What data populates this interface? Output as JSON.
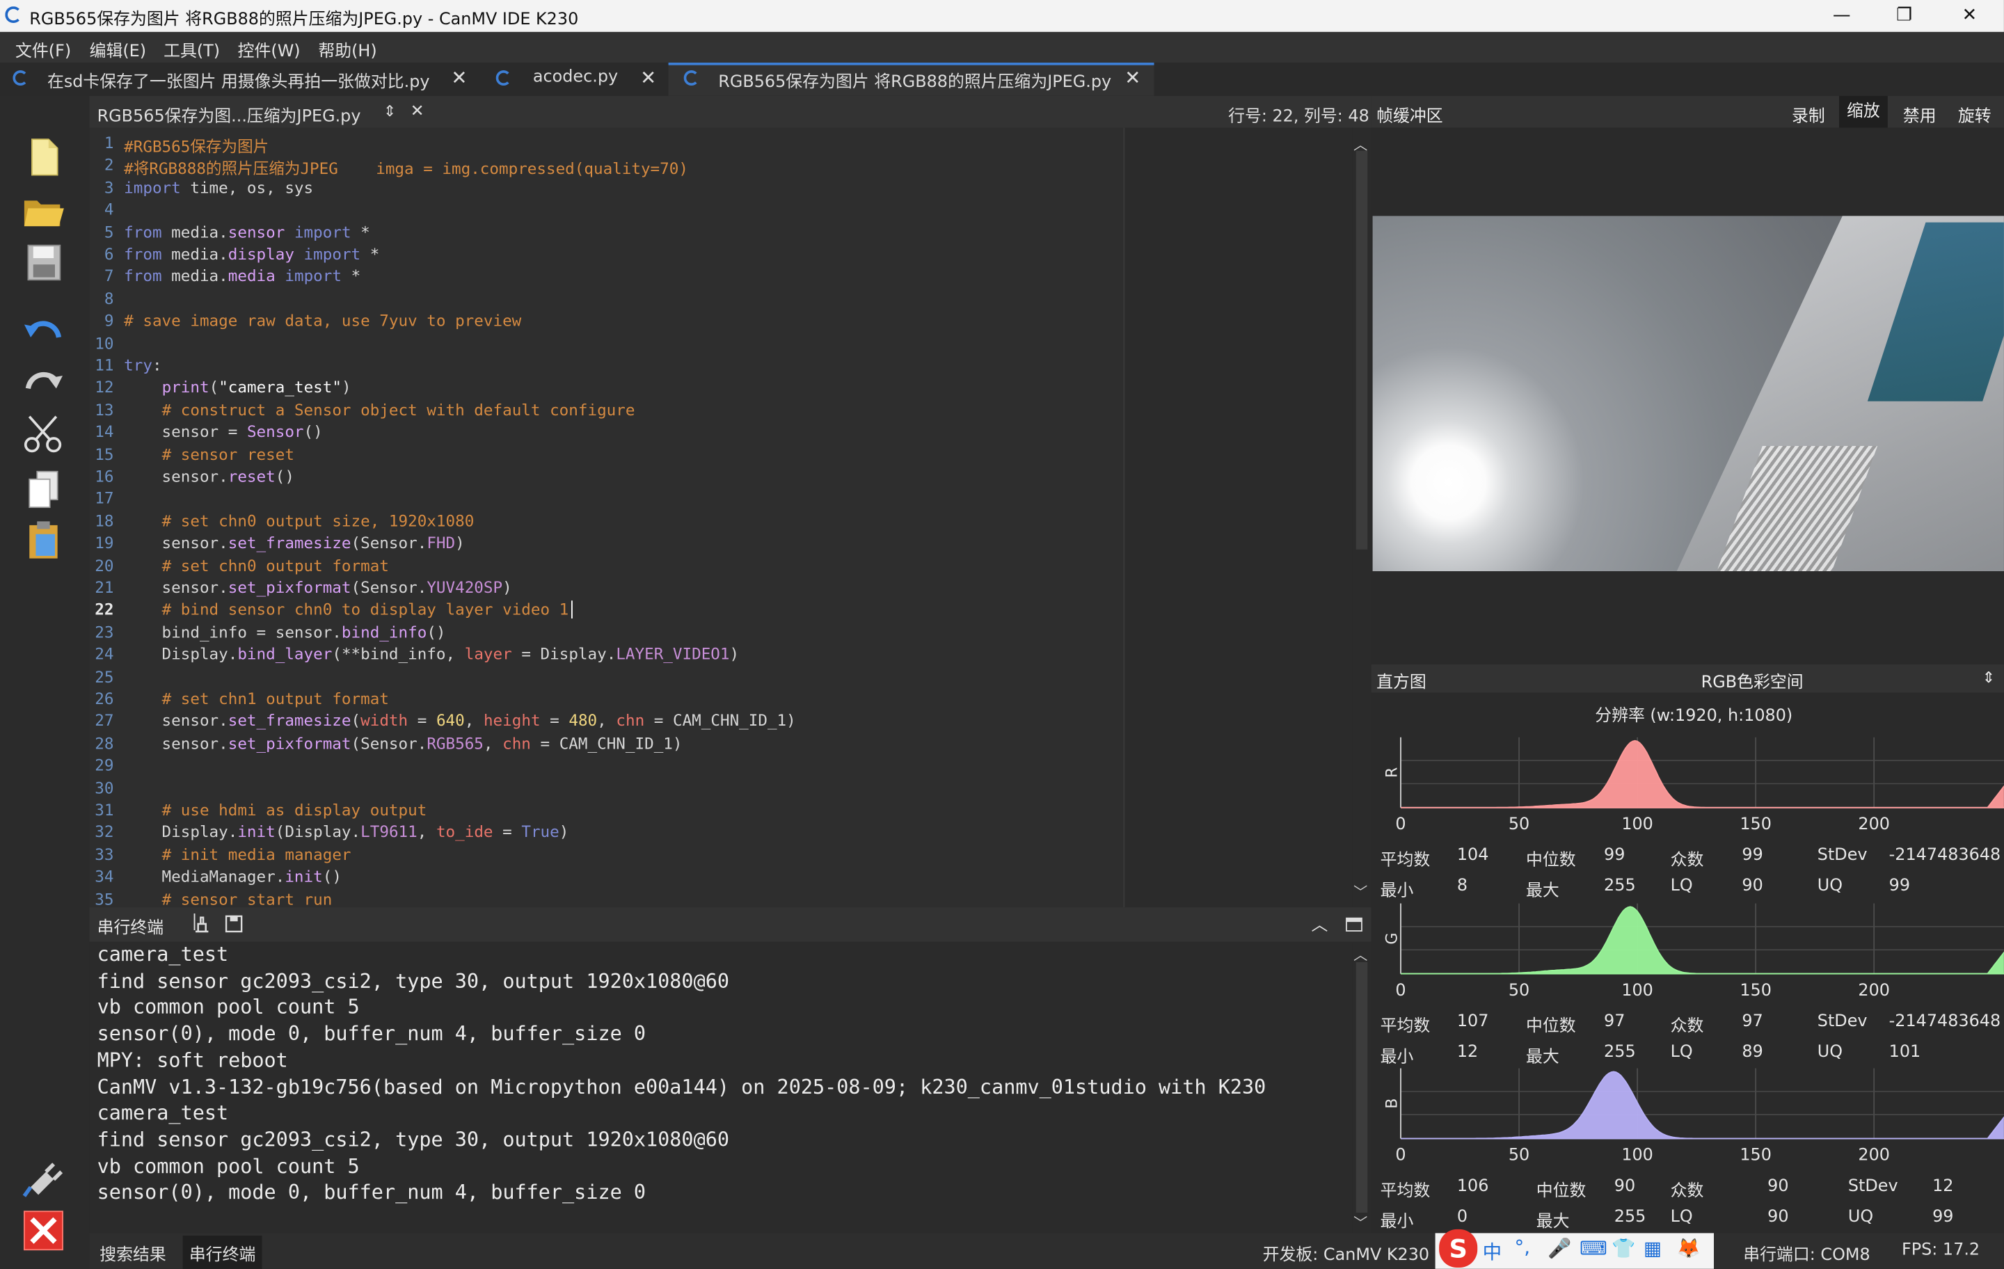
{
  "window": {
    "title": "RGB565保存为图片 将RGB88的照片压缩为JPEG.py - CanMV IDE K230",
    "minimize": "—",
    "restore": "❐",
    "close": "✕"
  },
  "menu": [
    "文件(F)",
    "编辑(E)",
    "工具(T)",
    "控件(W)",
    "帮助(H)"
  ],
  "tabs": [
    {
      "label": "在sd卡保存了一张图片 用摄像头再拍一张做对比.py",
      "close": "✕"
    },
    {
      "label": "acodec.py",
      "close": "✕"
    },
    {
      "label": "RGB565保存为图片 将RGB88的照片压缩为JPEG.py",
      "close": "✕"
    }
  ],
  "editor": {
    "file_selector": "RGB565保存为图...压缩为JPEG.py",
    "file_selector_arrows": "⇕",
    "close": "✕",
    "cursor_pos": "行号: 22, 列号: 48",
    "current_line": 22,
    "lines": [
      "#RGB565保存为图片",
      "#将RGB888的照片压缩为JPEG    imga = img.compressed(quality=70)",
      "import time, os, sys",
      "",
      "from media.sensor import *",
      "from media.display import *",
      "from media.media import *",
      "",
      "# save image raw data, use 7yuv to preview",
      "",
      "try:",
      "    print(\"camera_test\")",
      "    # construct a Sensor object with default configure",
      "    sensor = Sensor()",
      "    # sensor reset",
      "    sensor.reset()",
      "",
      "    # set chn0 output size, 1920x1080",
      "    sensor.set_framesize(Sensor.FHD)",
      "    # set chn0 output format",
      "    sensor.set_pixformat(Sensor.YUV420SP)",
      "    # bind sensor chn0 to display layer video 1",
      "    bind_info = sensor.bind_info()",
      "    Display.bind_layer(**bind_info, layer = Display.LAYER_VIDEO1)",
      "",
      "    # set chn1 output format",
      "    sensor.set_framesize(width = 640, height = 480, chn = CAM_CHN_ID_1)",
      "    sensor.set_pixformat(Sensor.RGB565, chn = CAM_CHN_ID_1)",
      "",
      "",
      "    # use hdmi as display output",
      "    Display.init(Display.LT9611, to_ide = True)",
      "    # init media manager",
      "    MediaManager.init()",
      "    # sensor start run"
    ]
  },
  "terminal": {
    "title": "串行终端",
    "lines": [
      "camera_test",
      "find sensor gc2093_csi2, type 30, output 1920x1080@60",
      "vb common pool count 5",
      "sensor(0), mode 0, buffer_num 4, buffer_size 0",
      "MPY: soft reboot",
      "CanMV v1.3-132-gb19c756(based on Micropython e00a144) on 2025-08-09; k230_canmv_01studio with K230",
      "camera_test",
      "find sensor gc2093_csi2, type 30, output 1920x1080@60",
      "vb common pool count 5",
      "sensor(0), mode 0, buffer_num 4, buffer_size 0"
    ]
  },
  "framebuffer": {
    "title": "帧缓冲区",
    "buttons": [
      "录制",
      "缩放",
      "禁用",
      "旋转"
    ],
    "active_button": "缩放"
  },
  "histogram": {
    "title": "直方图",
    "colorspace": "RGB色彩空间",
    "colorspace_arrows": "⇕",
    "resolution": "分辨率 (w:1920, h:1080)",
    "axis_ticks": [
      "0",
      "50",
      "100",
      "150",
      "200"
    ],
    "channels": [
      {
        "name": "R",
        "color": "#ff9a9a",
        "stats": {
          "mean_label": "平均数",
          "mean": "104",
          "median_label": "中位数",
          "median": "99",
          "mode_label": "众数",
          "mode": "99",
          "stdev_label": "StDev",
          "stdev": "-2147483648",
          "min_label": "最小",
          "min": "8",
          "max_label": "最大",
          "max": "255",
          "lq_label": "LQ",
          "lq": "90",
          "uq_label": "UQ",
          "uq": "99"
        }
      },
      {
        "name": "G",
        "color": "#9af59a",
        "stats": {
          "mean_label": "平均数",
          "mean": "107",
          "median_label": "中位数",
          "median": "97",
          "mode_label": "众数",
          "mode": "97",
          "stdev_label": "StDev",
          "stdev": "-2147483648",
          "min_label": "最小",
          "min": "12",
          "max_label": "最大",
          "max": "255",
          "lq_label": "LQ",
          "lq": "89",
          "uq_label": "UQ",
          "uq": "101"
        }
      },
      {
        "name": "B",
        "color": "#b7b0f7",
        "stats": {
          "mean_label": "平均数",
          "mean": "106",
          "median_label": "中位数",
          "median": "90",
          "mode_label": "众数",
          "mode": "90",
          "stdev_label": "StDev",
          "stdev": "12",
          "min_label": "最小",
          "min": "0",
          "max_label": "最大",
          "max": "255",
          "lq_label": "LQ",
          "lq": "90",
          "uq_label": "UQ",
          "uq": "99"
        }
      }
    ]
  },
  "bottom_tabs": [
    "搜索结果",
    "串行终端"
  ],
  "status": {
    "board": "开发板: CanMV K230",
    "port": "串行端口: COM8",
    "fps": "FPS:  17.2",
    "ime_logo": "S",
    "ime_lang": "中"
  }
}
